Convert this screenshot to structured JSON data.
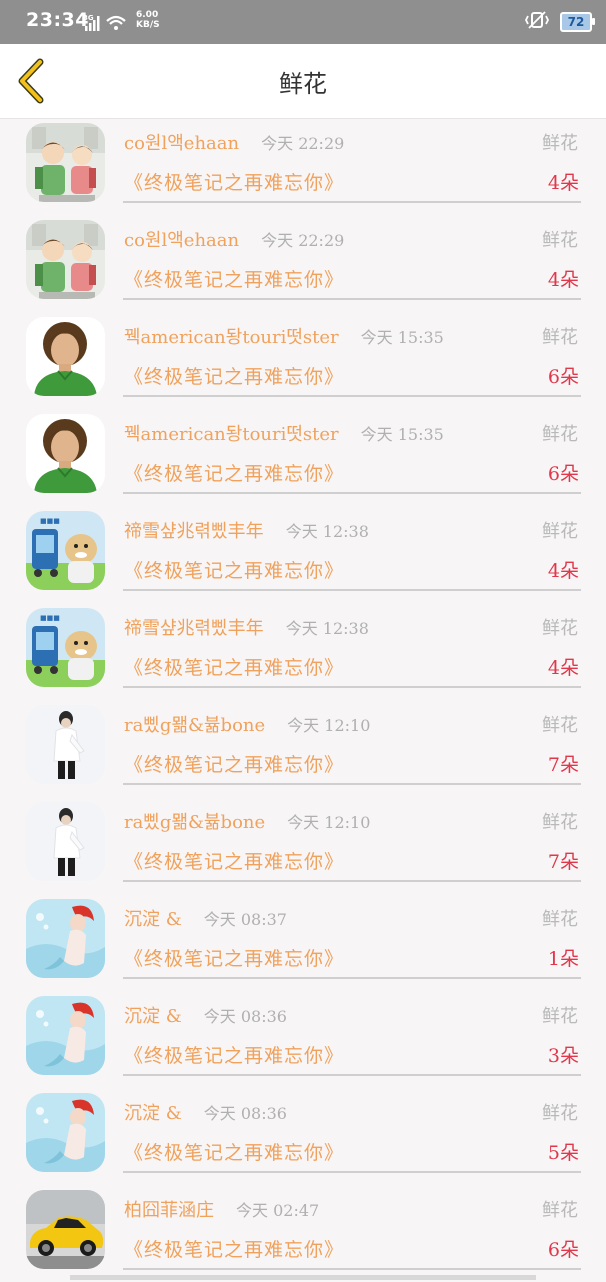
{
  "status_bar": {
    "time": "23:34",
    "network": "3G",
    "speed_value": "6.00",
    "speed_unit": "KB/S",
    "battery": "72"
  },
  "header": {
    "title": "鲜花"
  },
  "list": [
    {
      "name": "co원l액ehaan",
      "time": "今天 22:29",
      "kind": "鲜花",
      "book": "《终极笔记之再难忘你》",
      "count": "4朵",
      "avatar": "two-boys-avatar"
    },
    {
      "name": "co원l액ehaan",
      "time": "今天 22:29",
      "kind": "鲜花",
      "book": "《终极笔记之再难忘你》",
      "count": "4朵",
      "avatar": "two-boys-avatar"
    },
    {
      "name": "꿱american돵touri떳ster",
      "time": "今天 15:35",
      "kind": "鲜花",
      "book": "《终极笔记之再难忘你》",
      "count": "6朵",
      "avatar": "boy-green-shirt-avatar"
    },
    {
      "name": "꿱american돵touri떳ster",
      "time": "今天 15:35",
      "kind": "鲜花",
      "book": "《终极笔记之再难忘你》",
      "count": "6朵",
      "avatar": "boy-green-shirt-avatar"
    },
    {
      "name": "禘雪샾兆렦삤丰年",
      "time": "今天 12:38",
      "kind": "鲜花",
      "book": "《终极笔记之再难忘你》",
      "count": "4朵",
      "avatar": "cartoon-avatar"
    },
    {
      "name": "禘雪샾兆렦삤丰年",
      "time": "今天 12:38",
      "kind": "鲜花",
      "book": "《终极笔记之再难忘你》",
      "count": "4朵",
      "avatar": "cartoon-avatar"
    },
    {
      "name": "ra삤g뫪&뷺bone",
      "time": "今天 12:10",
      "kind": "鲜花",
      "book": "《终极笔记之再难忘你》",
      "count": "7朵",
      "avatar": "white-figure-avatar"
    },
    {
      "name": "ra삤g뫪&뷺bone",
      "time": "今天 12:10",
      "kind": "鲜花",
      "book": "《终极笔记之再难忘你》",
      "count": "7朵",
      "avatar": "white-figure-avatar"
    },
    {
      "name": "沉淀 &",
      "time": "今天 08:37",
      "kind": "鲜花",
      "book": "《终极笔记之再难忘你》",
      "count": "1朵",
      "avatar": "mermaid-avatar"
    },
    {
      "name": "沉淀 &",
      "time": "今天 08:36",
      "kind": "鲜花",
      "book": "《终极笔记之再难忘你》",
      "count": "3朵",
      "avatar": "mermaid-avatar"
    },
    {
      "name": "沉淀 &",
      "time": "今天 08:36",
      "kind": "鲜花",
      "book": "《终极笔记之再难忘你》",
      "count": "5朵",
      "avatar": "mermaid-avatar"
    },
    {
      "name": "柏囧菲涵庄",
      "time": "今天 02:47",
      "kind": "鲜花",
      "book": "《终极笔记之再难忘你》",
      "count": "6朵",
      "avatar": "yellow-car-avatar"
    }
  ],
  "colors": {
    "accent": "#f0a25c",
    "count": "#e0374a",
    "muted": "#b0b0b0",
    "back_arrow": "#f2c11c"
  }
}
